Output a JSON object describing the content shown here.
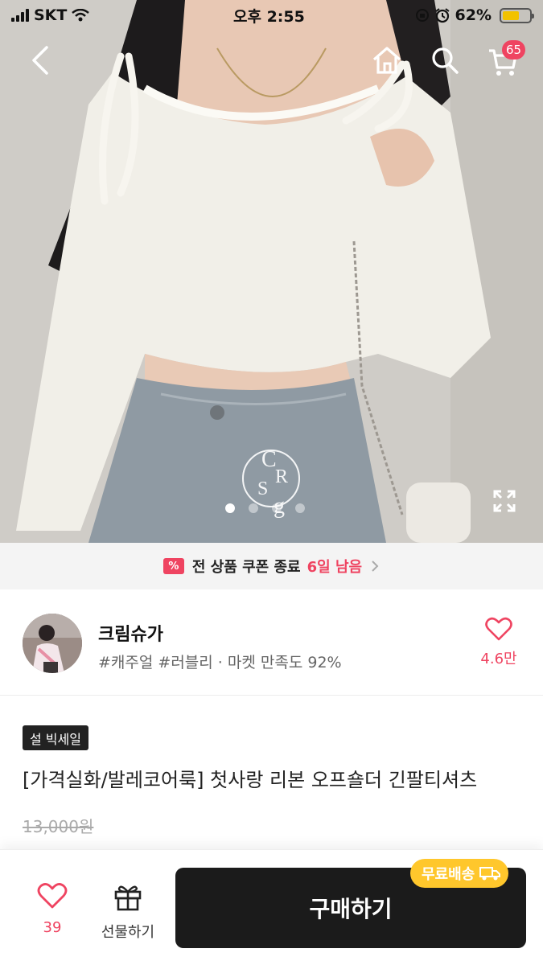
{
  "status_bar": {
    "carrier": "SKT",
    "time": "오후 2:55",
    "battery_percent_text": "62%",
    "battery_level": 0.62
  },
  "nav": {
    "back_icon": "chevron-left-icon",
    "home_icon": "home-icon",
    "search_icon": "search-icon",
    "cart_icon": "cart-icon",
    "cart_count": "65"
  },
  "gallery": {
    "watermark": "CRSg",
    "image_count": 4,
    "active_index": 0
  },
  "coupon_banner": {
    "icon_text": "%",
    "text": "전 상품 쿠폰 종료",
    "highlight": "6일 남음"
  },
  "shop": {
    "name": "크림슈가",
    "tags": "#캐주얼 #러블리 · 마켓 만족도 92%",
    "like_count": "4.6만"
  },
  "product": {
    "sale_badge": "설 빅세일",
    "title": "[가격실화/발레코어룩] 첫사랑 리본 오프숄더 긴팔티셔츠",
    "original_price": "13,000원"
  },
  "bottom_bar": {
    "like_count": "39",
    "gift_label": "선물하기",
    "buy_label": "구매하기",
    "free_shipping": "무료배송"
  },
  "colors": {
    "accent": "#ef4461",
    "buy_button": "#1b1b1b",
    "free_shipping": "#ffc72c"
  }
}
